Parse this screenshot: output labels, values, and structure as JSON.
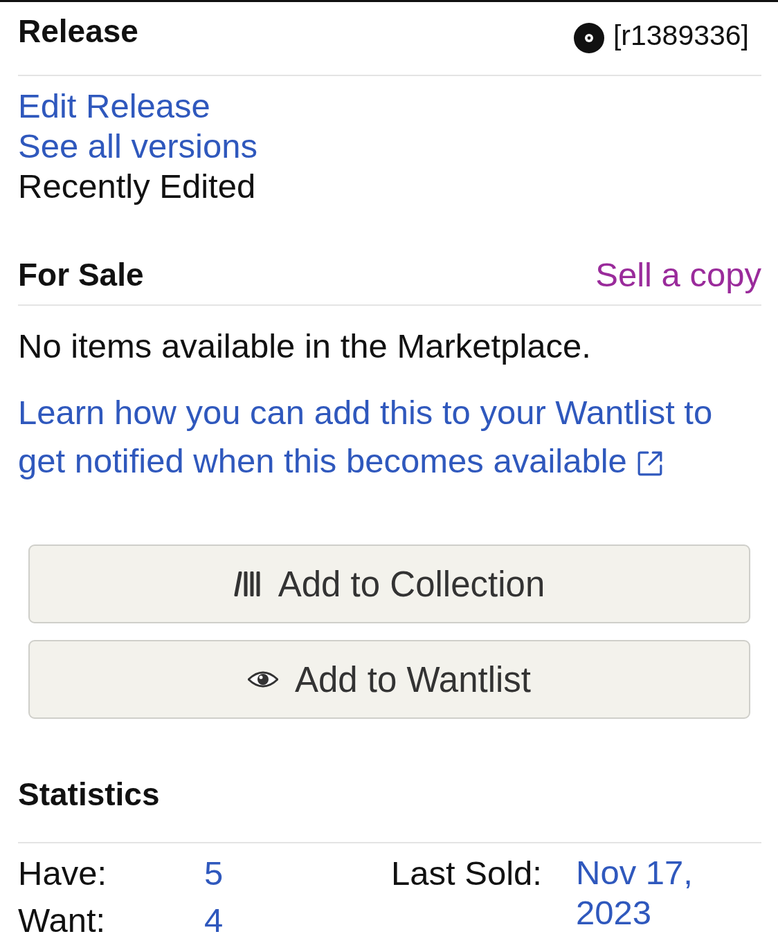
{
  "header": {
    "title": "Release",
    "release_id": "[r1389336]"
  },
  "links": [
    {
      "label": "Edit Release",
      "kind": "link"
    },
    {
      "label": "See all versions",
      "kind": "link"
    },
    {
      "label": "Recently Edited",
      "kind": "text"
    }
  ],
  "for_sale": {
    "title": "For Sale",
    "action": "Sell a copy",
    "message": "No items available in the Marketplace.",
    "help_link": "Learn how you can add this to your Wantlist to get notified when this becomes available"
  },
  "buttons": [
    {
      "label": "Add to Collection",
      "kind": "collection"
    },
    {
      "label": "Add to Wantlist",
      "kind": "wantlist"
    }
  ],
  "statistics": {
    "title": "Statistics",
    "columns": [
      {
        "items": [
          {
            "label": "Have:",
            "value": "5"
          },
          {
            "label": "Want:",
            "value": "4"
          }
        ]
      },
      {
        "items": [
          {
            "label": "Last Sold:",
            "value": "Nov 17, 2023"
          }
        ]
      }
    ]
  }
}
